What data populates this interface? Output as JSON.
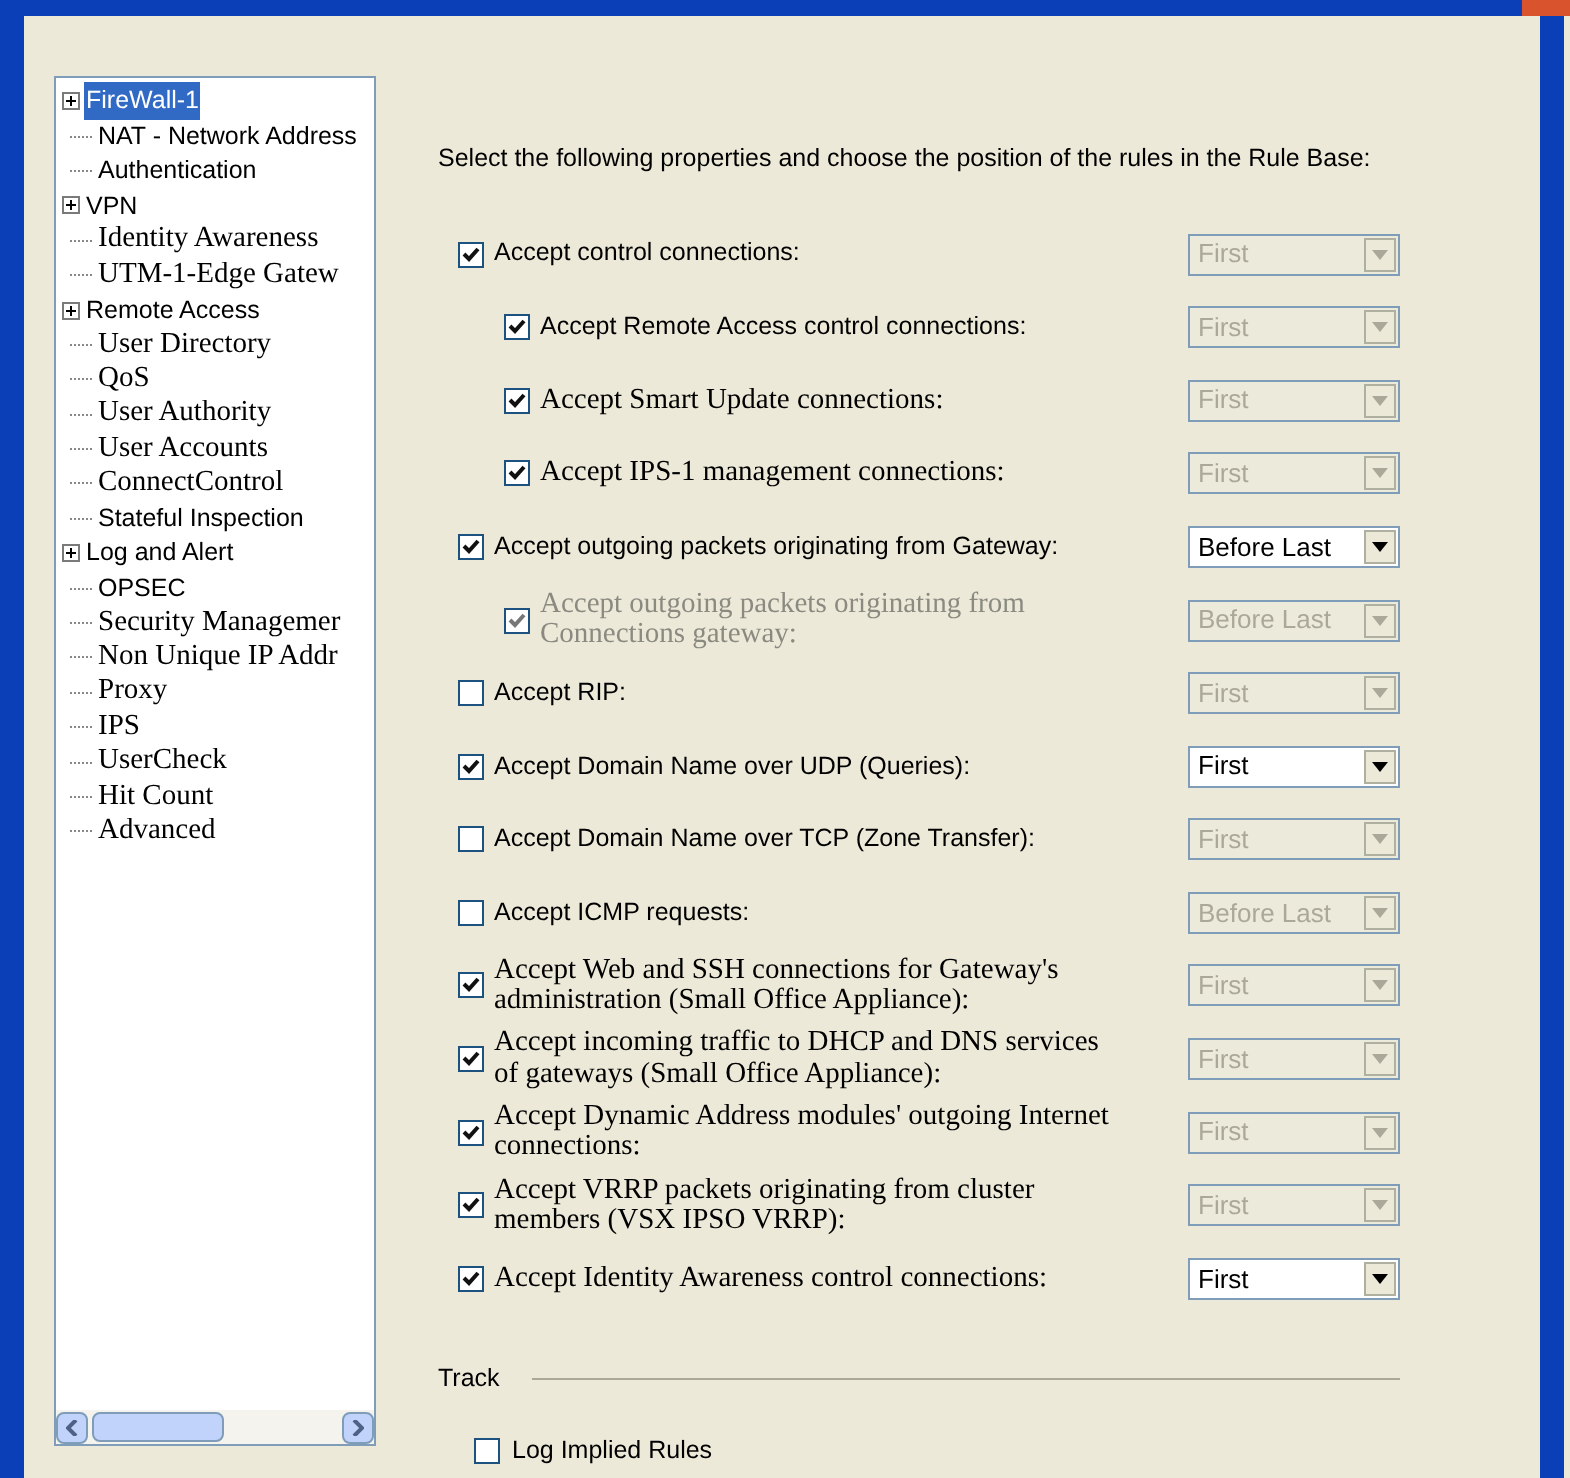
{
  "tree": {
    "items": [
      {
        "label": "FireWall-1",
        "expandable": true,
        "selected": true
      },
      {
        "label": "NAT - Network Address",
        "expandable": false,
        "selected": false
      },
      {
        "label": "Authentication",
        "expandable": false,
        "selected": false
      },
      {
        "label": "VPN",
        "expandable": true,
        "selected": false
      },
      {
        "label": "Identity Awareness",
        "expandable": false,
        "selected": false
      },
      {
        "label": "UTM-1-Edge Gatew",
        "expandable": false,
        "selected": false
      },
      {
        "label": "Remote Access",
        "expandable": true,
        "selected": false
      },
      {
        "label": "User Directory",
        "expandable": false,
        "selected": false
      },
      {
        "label": "QoS",
        "expandable": false,
        "selected": false
      },
      {
        "label": "User Authority",
        "expandable": false,
        "selected": false
      },
      {
        "label": "User Accounts",
        "expandable": false,
        "selected": false
      },
      {
        "label": "ConnectControl",
        "expandable": false,
        "selected": false
      },
      {
        "label": "Stateful Inspection",
        "expandable": false,
        "selected": false
      },
      {
        "label": "Log and Alert",
        "expandable": true,
        "selected": false
      },
      {
        "label": "OPSEC",
        "expandable": false,
        "selected": false
      },
      {
        "label": "Security Managemer",
        "expandable": false,
        "selected": false
      },
      {
        "label": "Non Unique IP Addr",
        "expandable": false,
        "selected": false
      },
      {
        "label": "Proxy",
        "expandable": false,
        "selected": false
      },
      {
        "label": "IPS",
        "expandable": false,
        "selected": false
      },
      {
        "label": "UserCheck",
        "expandable": false,
        "selected": false
      },
      {
        "label": "Hit Count",
        "expandable": false,
        "selected": false
      },
      {
        "label": "Advanced",
        "expandable": false,
        "selected": false
      }
    ]
  },
  "intro": "Select the following properties and choose the position of the rules in the Rule Base:",
  "rules": [
    {
      "label": "Accept  control connections:",
      "checked": true,
      "indented": false,
      "disabled": false,
      "position": "First",
      "position_enabled": false
    },
    {
      "label": "Accept Remote Access control connections:",
      "checked": true,
      "indented": true,
      "disabled": false,
      "position": "First",
      "position_enabled": false
    },
    {
      "label": "Accept Smart Update connections:",
      "checked": true,
      "indented": true,
      "disabled": false,
      "position": "First",
      "position_enabled": false
    },
    {
      "label": "Accept IPS-1 management connections:",
      "checked": true,
      "indented": true,
      "disabled": false,
      "position": "First",
      "position_enabled": false
    },
    {
      "label": "Accept outgoing packets originating from Gateway:",
      "checked": true,
      "indented": false,
      "disabled": false,
      "position": "Before Last",
      "position_enabled": true
    },
    {
      "label": "Accept outgoing packets originating from Connections gateway:",
      "checked": true,
      "indented": true,
      "disabled": true,
      "position": "Before Last",
      "position_enabled": false
    },
    {
      "label": "Accept RIP:",
      "checked": false,
      "indented": false,
      "disabled": false,
      "position": "First",
      "position_enabled": false
    },
    {
      "label": "Accept Domain Name over UDP (Queries):",
      "checked": true,
      "indented": false,
      "disabled": false,
      "position": "First",
      "position_enabled": true
    },
    {
      "label": "Accept Domain Name over TCP (Zone Transfer):",
      "checked": false,
      "indented": false,
      "disabled": false,
      "position": "First",
      "position_enabled": false
    },
    {
      "label": "Accept ICMP requests:",
      "checked": false,
      "indented": false,
      "disabled": false,
      "position": "Before Last",
      "position_enabled": false
    },
    {
      "label": "Accept Web and SSH connections for Gateway's administration (Small Office Appliance):",
      "checked": true,
      "indented": false,
      "disabled": false,
      "position": "First",
      "position_enabled": false
    },
    {
      "label": "Accept incoming traffic to DHCP and DNS services of gateways (Small Office Appliance):",
      "checked": true,
      "indented": false,
      "disabled": false,
      "position": "First",
      "position_enabled": false
    },
    {
      "label": "Accept Dynamic Address modules' outgoing Internet connections:",
      "checked": true,
      "indented": false,
      "disabled": false,
      "position": "First",
      "position_enabled": false
    },
    {
      "label": "Accept VRRP packets originating from cluster members (VSX IPSO VRRP):",
      "checked": true,
      "indented": false,
      "disabled": false,
      "position": "First",
      "position_enabled": false
    },
    {
      "label": "Accept Identity Awareness control connections:",
      "checked": true,
      "indented": false,
      "disabled": false,
      "position": "First",
      "position_enabled": true
    }
  ],
  "track": {
    "title": "Track",
    "log_implied_rules": {
      "label": "Log Implied Rules",
      "checked": false
    }
  }
}
